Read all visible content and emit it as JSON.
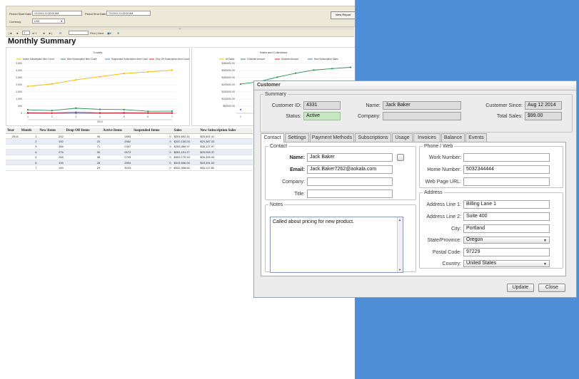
{
  "report": {
    "params": {
      "start_label": "Period Start Date",
      "start_value": "1/1/2014 12:00:00 AM",
      "end_label": "Period End Date",
      "end_value": "7/1/2014 12:00:00 AM",
      "currency_label": "Currency",
      "currency_value": "USD",
      "view_button": "View Report"
    },
    "toolbar": {
      "first": "|◄",
      "prev": "◄",
      "page": "1",
      "of": "of 1",
      "next": "►",
      "last": "►|",
      "find_next": "Find | Next"
    },
    "title": "Monthly Summary",
    "table": {
      "headers": [
        "Year",
        "Month",
        "New Items",
        "Drop Off Items",
        "Active Items",
        "Suspended Items",
        "Sales",
        "New Subscription Sales"
      ],
      "year": "2014",
      "rows": [
        [
          "1",
          "242",
          "40",
          "1893",
          "0",
          "$204,692.41",
          "$25,601.41"
        ],
        [
          "2",
          "192",
          "23",
          "2062",
          "0",
          "$222,130.03",
          "$20,387.03"
        ],
        [
          "3",
          "356",
          "71",
          "2347",
          "0",
          "$253,366.97",
          "$38,127.97"
        ],
        [
          "4",
          "276",
          "30",
          "2573",
          "0",
          "$281,191.27",
          "$29,059.37"
        ],
        [
          "5",
          "258",
          "38",
          "2793",
          "0",
          "$303,170.94",
          "$26,325.94"
        ],
        [
          "6",
          "139",
          "28",
          "2904",
          "0",
          "$313,546.00",
          "$15,391.00"
        ],
        [
          "7",
          "149",
          "29",
          "3024",
          "0",
          "$322,498.82",
          "$16,117.82"
        ]
      ]
    }
  },
  "chart_data": [
    {
      "type": "line",
      "title": "Counts",
      "categories": [
        "1",
        "2",
        "3",
        "4",
        "5",
        "6",
        "7"
      ],
      "xlabel": "2014",
      "ylim": [
        0,
        3500
      ],
      "yticks": [
        "3,500",
        "3,000",
        "2,500",
        "2,000",
        "1,500",
        "1,000",
        "500",
        "0"
      ],
      "series": [
        {
          "name": "Active Subscription Item Count",
          "color": "#f5b800",
          "values": [
            1893,
            2062,
            2347,
            2573,
            2793,
            2904,
            3024
          ]
        },
        {
          "name": "New Subscription Item Count",
          "color": "#2e8b57",
          "values": [
            242,
            192,
            356,
            276,
            258,
            139,
            149
          ]
        },
        {
          "name": "Suspended Subscription Item Count",
          "color": "#4a7fd4",
          "values": [
            0,
            0,
            0,
            0,
            0,
            0,
            0
          ]
        },
        {
          "name": "Drop Off Subscription Item Count",
          "color": "#d9262c",
          "values": [
            40,
            23,
            71,
            30,
            38,
            28,
            29
          ]
        }
      ]
    },
    {
      "type": "line",
      "title": "Sales and Collections",
      "categories": [
        "1",
        "2",
        "3",
        "4",
        "5",
        "6",
        "7"
      ],
      "ylim": [
        0,
        350000
      ],
      "yticks": [
        "$350000.00",
        "$300000.00",
        "$250000.00",
        "$200000.00",
        "$150000.00",
        "$100000.00",
        "$50000.00"
      ],
      "series": [
        {
          "name": "All Sales",
          "color": "#f5b800",
          "values": []
        },
        {
          "name": "Collected Amount",
          "color": "#2e8b57",
          "values": [
            204692,
            222130,
            253366,
            281191,
            303170,
            313546,
            322498
          ]
        },
        {
          "name": "Declined Amount",
          "color": "#d9262c",
          "values": []
        },
        {
          "name": "New Subscription Sales",
          "color": "#4a7fd4",
          "values": [
            25601
          ]
        }
      ]
    }
  ],
  "dialog": {
    "title": "Customer",
    "summary": {
      "legend": "Summary",
      "customer_id_label": "Customer ID:",
      "customer_id": "4331",
      "name_label": "Name:",
      "name": "Jack Baker",
      "customer_since_label": "Customer Since:",
      "customer_since": "Aug 12 2014",
      "status_label": "Status:",
      "status": "Active",
      "company_label": "Company:",
      "company": "",
      "total_sales_label": "Total Sales:",
      "total_sales": "$99.00"
    },
    "tabs": [
      "Contact",
      "Settings",
      "Payment Methods",
      "Subscriptions",
      "Usage",
      "Invoices",
      "Balance",
      "Events"
    ],
    "contact": {
      "legend": "Contact",
      "name_label": "Name:",
      "name": "Jack Baker",
      "email_label": "Email:",
      "email": "Jack.Baker7262@aokala.com",
      "company_label": "Company:",
      "company": "",
      "title_label": "Title:",
      "title": ""
    },
    "phone": {
      "legend": "Phone / Web",
      "work_label": "Work Number:",
      "work": "",
      "home_label": "Home Number:",
      "home": "5032344444",
      "web_label": "Web Page URL:",
      "web": ""
    },
    "notes": {
      "legend": "Notes",
      "text": "Called about pricing for new product."
    },
    "address": {
      "legend": "Address",
      "line1_label": "Address Line 1:",
      "line1": "Billing Lane 1",
      "line2_label": "Address Line 2:",
      "line2": "Suite 400",
      "city_label": "City:",
      "city": "Portland",
      "state_label": "State/Province:",
      "state": "Oregon",
      "postal_label": "Postal Code:",
      "postal": "97229",
      "country_label": "Country:",
      "country": "United States"
    },
    "buttons": {
      "update": "Update",
      "close": "Close"
    }
  }
}
